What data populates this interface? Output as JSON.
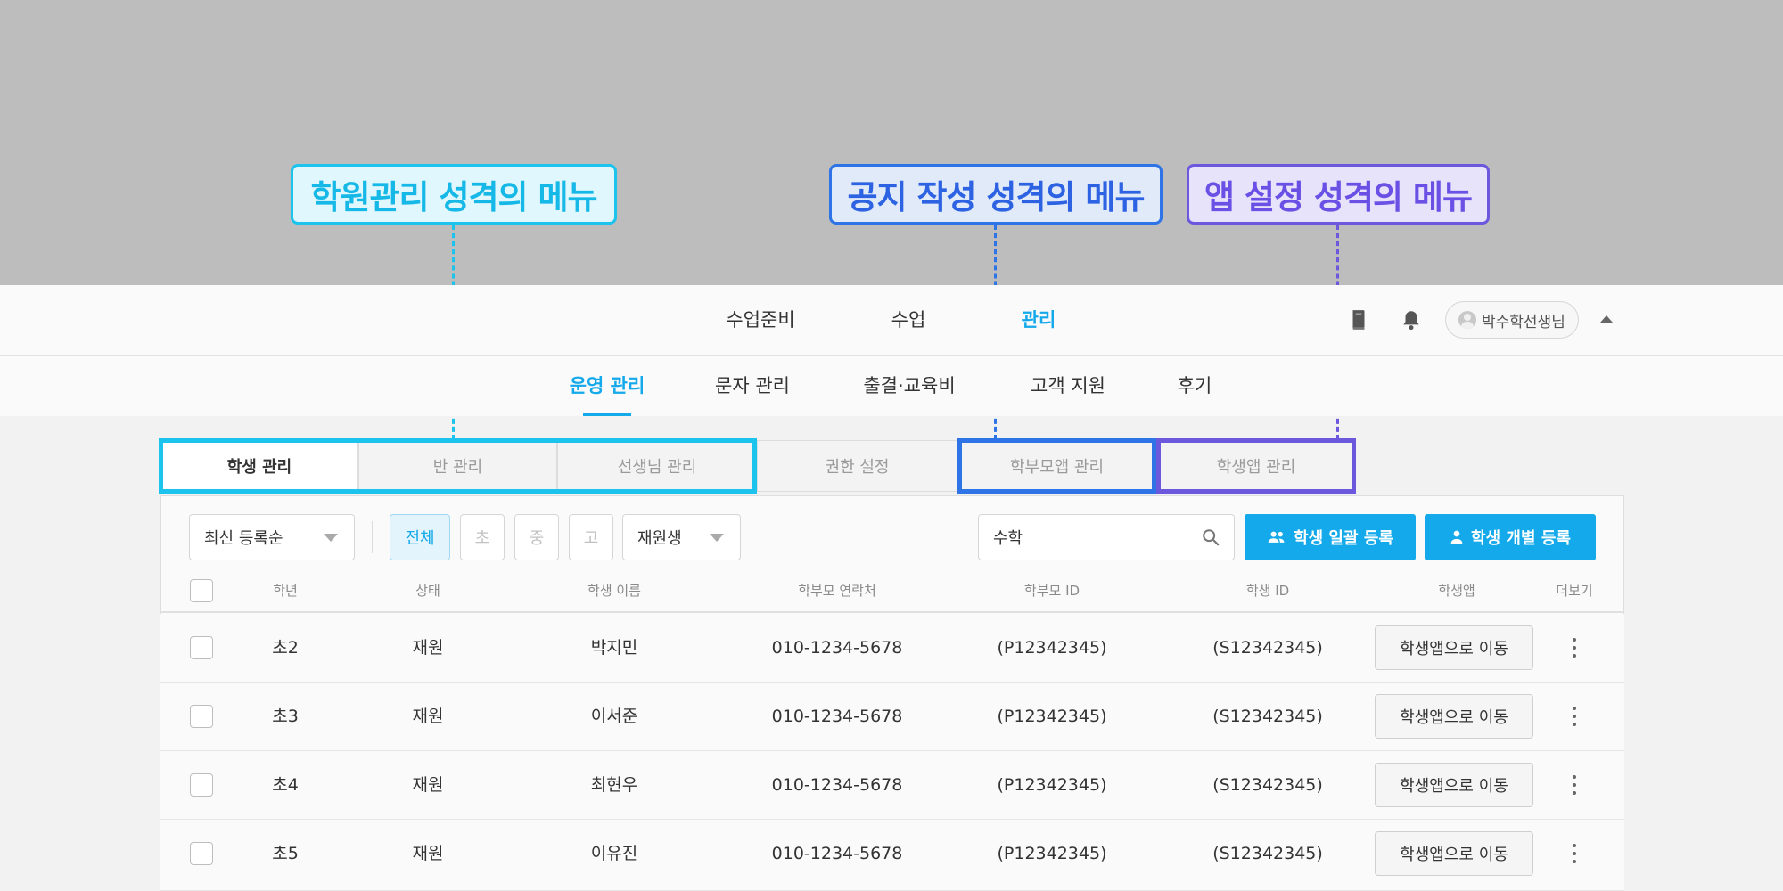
{
  "callouts": [
    {
      "text": "학원관리 성격의 메뉴",
      "color": "#1cc3ec"
    },
    {
      "text": "공지 작성 성격의 메뉴",
      "color": "#2f74e6"
    },
    {
      "text": "앱 설정 성격의 메뉴",
      "color": "#6c58dc"
    }
  ],
  "gnb": {
    "items": [
      "수업준비",
      "수업",
      "관리"
    ],
    "active": "관리",
    "book_icon": "book-icon",
    "bell_icon": "bell-icon",
    "profile_name": "박수학선생님",
    "profile_icon": "avatar-icon",
    "collapse_icon": "caret-up-icon"
  },
  "lnb": {
    "items": [
      "운영 관리",
      "문자 관리",
      "출결·교육비",
      "고객 지원",
      "후기"
    ],
    "active": "운영 관리"
  },
  "tabs": [
    "학생 관리",
    "반 관리",
    "선생님 관리",
    "권한 설정",
    "학부모앱 관리",
    "학생앱 관리"
  ],
  "active_tab": "학생 관리",
  "filters": {
    "sort": "최신 등록순",
    "grades": [
      "전체",
      "초",
      "중",
      "고"
    ],
    "active_grade": "전체",
    "status": "재원생",
    "search_value": "수학",
    "search_icon": "search-icon"
  },
  "actions": {
    "bulk_register": "학생 일괄 등록",
    "single_register": "학생 개별 등록",
    "bulk_icon": "group-icon",
    "single_icon": "person-icon"
  },
  "table": {
    "columns": [
      "학년",
      "상태",
      "학생 이름",
      "학부모 연락처",
      "학부모 ID",
      "학생 ID",
      "학생앱",
      "더보기"
    ],
    "rows": [
      {
        "grade": "초2",
        "status": "재원",
        "name": "박지민",
        "phone": "010-1234-5678",
        "parent_id": "(P12342345)",
        "student_id": "(S12342345)",
        "app": "학생앱으로 이동"
      },
      {
        "grade": "초3",
        "status": "재원",
        "name": "이서준",
        "phone": "010-1234-5678",
        "parent_id": "(P12342345)",
        "student_id": "(S12342345)",
        "app": "학생앱으로 이동"
      },
      {
        "grade": "초4",
        "status": "재원",
        "name": "최현우",
        "phone": "010-1234-5678",
        "parent_id": "(P12342345)",
        "student_id": "(S12342345)",
        "app": "학생앱으로 이동"
      },
      {
        "grade": "초5",
        "status": "재원",
        "name": "이유진",
        "phone": "010-1234-5678",
        "parent_id": "(P12342345)",
        "student_id": "(S12342345)",
        "app": "학생앱으로 이동"
      }
    ],
    "more_icon": "more-vertical-icon"
  }
}
